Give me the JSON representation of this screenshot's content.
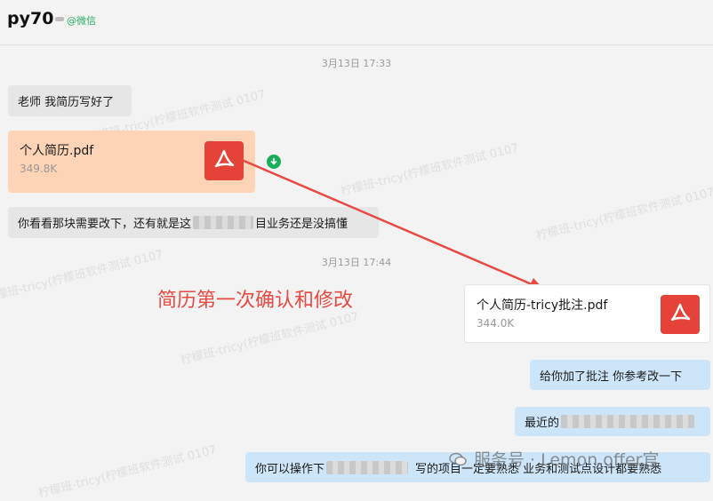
{
  "header": {
    "name": "py70",
    "wechat_tag": "@微信"
  },
  "timestamps": [
    "3月13日 17:33",
    "3月13日 17:44"
  ],
  "messages": {
    "m1": "老师 我简历写好了",
    "m3_pre": "你看看那块需要改下，还有就是这",
    "m3_post": "目业务还是没搞懂",
    "m5": "给你加了批注 你参考改一下",
    "m6_pre": "最近的",
    "m7_pre": "你可以操作下",
    "m7_post": "写的项目一定要熟悉 业务和测试点设计都要熟悉"
  },
  "files": [
    {
      "name": "个人简历.pdf",
      "size": "349.8K"
    },
    {
      "name": "个人简历-tricy批注.pdf",
      "size": "344.0K"
    }
  ],
  "annotation": "简历第一次确认和修改",
  "footer_text": "服务号 · Lemon offer官",
  "watermark_text": "柠檬班-tricy(柠檬班软件测试 0107",
  "colors": {
    "pdf_red": "#e54339",
    "peach_file": "#ffd3b5",
    "outgoing_blue": "#cde5f8",
    "arrow_red": "#e84a43",
    "download_green": "#1aad5a"
  },
  "icons": [
    "pdf-icon",
    "download-icon",
    "wechat-logo-icon"
  ]
}
